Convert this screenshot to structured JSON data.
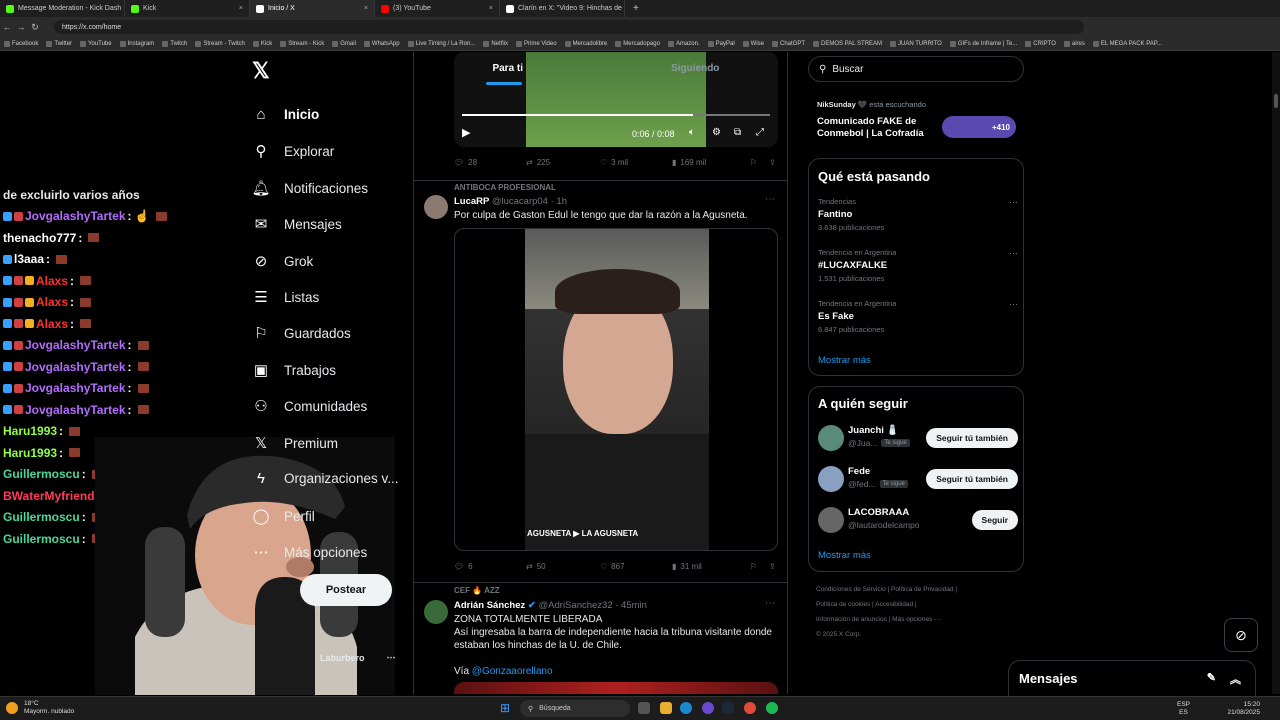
{
  "browser": {
    "tabs": [
      {
        "title": "Message Moderation - Kick Dash",
        "color": "#53fc18"
      },
      {
        "title": "Kick",
        "color": "#53fc18"
      },
      {
        "title": "Inicio / X",
        "color": "#ffffff"
      },
      {
        "title": "(3) YouTube",
        "color": "#ff0000"
      },
      {
        "title": "Clarín en X: \"Video 9: Hinchas de",
        "color": "#ffffff"
      }
    ],
    "url": "https://x.com/home",
    "bookmarks": [
      "Facebook",
      "Twitter",
      "YouTube",
      "Instagram",
      "Twitch",
      "Stream - Twitch",
      "Kick",
      "Stream - Kick",
      "Gmail",
      "WhatsApp",
      "Live Timing / La Ron...",
      "Netflix",
      "Prime Video",
      "Mercadolibre",
      "Mercadopago",
      "Amazon.",
      "PayPal",
      "Wise",
      "ChatGPT",
      "DEMOS PAL STREAM",
      "JUAN TURRITO",
      "GIFs de Inframe | Te...",
      "CRIPTO",
      "aires",
      "EL MEGA PACK PAP..."
    ]
  },
  "chat": {
    "header": "de excluirlo varios años",
    "lines": [
      {
        "user": "JovgalashyTartek",
        "color": "#b36bff",
        "badges": 2,
        "suffix": ": ☝"
      },
      {
        "user": "thenacho777",
        "color": "#ffffff",
        "badges": 0,
        "suffix": ":"
      },
      {
        "user": "l3aaa",
        "color": "#ffffff",
        "badges": 1,
        "suffix": ":"
      },
      {
        "user": "Alaxs",
        "color": "#ff3030",
        "badges": 3,
        "suffix": ":"
      },
      {
        "user": "Alaxs",
        "color": "#ff3030",
        "badges": 3,
        "suffix": ":"
      },
      {
        "user": "Alaxs",
        "color": "#ff3030",
        "badges": 3,
        "suffix": ":"
      },
      {
        "user": "JovgalashyTartek",
        "color": "#b36bff",
        "badges": 2,
        "suffix": ":"
      },
      {
        "user": "JovgalashyTartek",
        "color": "#b36bff",
        "badges": 2,
        "suffix": ":"
      },
      {
        "user": "JovgalashyTartek",
        "color": "#b36bff",
        "badges": 2,
        "suffix": ":"
      },
      {
        "user": "JovgalashyTartek",
        "color": "#b36bff",
        "badges": 2,
        "suffix": ":"
      },
      {
        "user": "Haru1993",
        "color": "#8fff4a",
        "badges": 0,
        "suffix": ":"
      },
      {
        "user": "Haru1993",
        "color": "#8fff4a",
        "badges": 0,
        "suffix": ":"
      },
      {
        "user": "Guillermoscu",
        "color": "#4ad89a",
        "badges": 0,
        "suffix": ":"
      },
      {
        "user": "BWaterMyfriend",
        "color": "#ff3a5a",
        "badges": 0,
        "suffix": ":"
      },
      {
        "user": "Guillermoscu",
        "color": "#4ad89a",
        "badges": 0,
        "suffix": ":"
      },
      {
        "user": "Guillermoscu",
        "color": "#4ad89a",
        "badges": 0,
        "suffix": ":"
      }
    ]
  },
  "xnav": {
    "items": [
      {
        "label": "Inicio",
        "icon": "home-icon",
        "glyph": "⌂"
      },
      {
        "label": "Explorar",
        "icon": "search-icon",
        "glyph": "⚲"
      },
      {
        "label": "Notificaciones",
        "icon": "bell-icon",
        "glyph": "🔔︎"
      },
      {
        "label": "Mensajes",
        "icon": "mail-icon",
        "glyph": "✉"
      },
      {
        "label": "Grok",
        "icon": "grok-icon",
        "glyph": "⊘"
      },
      {
        "label": "Listas",
        "icon": "list-icon",
        "glyph": "☰"
      },
      {
        "label": "Guardados",
        "icon": "bookmark-icon",
        "glyph": "⚐"
      },
      {
        "label": "Trabajos",
        "icon": "briefcase-icon",
        "glyph": "▣"
      },
      {
        "label": "Comunidades",
        "icon": "communities-icon",
        "glyph": "⚇"
      },
      {
        "label": "Premium",
        "icon": "x-premium-icon",
        "glyph": "𝕏"
      },
      {
        "label": "Organizaciones v...",
        "icon": "lightning-icon",
        "glyph": "ϟ"
      },
      {
        "label": "Perfil",
        "icon": "profile-icon",
        "glyph": "◯"
      },
      {
        "label": "Más opciones",
        "icon": "more-icon",
        "glyph": "⋯"
      }
    ],
    "post_label": "Postear",
    "account_name": "Laburbero"
  },
  "feed": {
    "tabs": [
      "Para ti",
      "Siguiendo"
    ],
    "post1": {
      "time": "0:06 / 0:08",
      "stats": {
        "replies": "28",
        "reposts": "225",
        "likes": "3 mil",
        "views": "169 mil"
      }
    },
    "post2": {
      "context": "ANTIBOCA PROFESIONAL",
      "name": "LucaRP",
      "handle": "@lucacarp04 · 1h",
      "text": "Por culpa de Gaston Edul le tengo que dar la razón a la Agusneta.",
      "watermark": "AGUSNETA",
      "watermark2": "LA AGUSNETA",
      "stats": {
        "replies": "6",
        "reposts": "50",
        "likes": "867",
        "views": "31 mil"
      }
    },
    "post3": {
      "context": "CEF 🔥 AZZ",
      "name": "Adrián Sánchez",
      "handle": "@AdriSanchez32 · 45min",
      "line1": "ZONA TOTALMENTE LIBERADA",
      "line2": "Así ingresaba la barra de independiente hacia la tribuna visitante donde estaban los hinchas de la U. de Chile.",
      "via_prefix": "Vía",
      "via_link": "@Gonzaaorellano"
    }
  },
  "right": {
    "search_placeholder": "Buscar",
    "spaces": {
      "host": "NikSunday 🖤",
      "status": "está escuchando",
      "title": "Comunicado FAKE de Conmebol | La Cofradía",
      "count": "+410"
    },
    "trends_title": "Qué está pasando",
    "trends": [
      {
        "cat": "Tendencias",
        "name": "Fantino",
        "count": "3.638 publicaciones"
      },
      {
        "cat": "Tendencia en Argentina",
        "name": "#LUCAXFALKE",
        "count": "1.531 publicaciones"
      },
      {
        "cat": "Tendencia en Argentina",
        "name": "Es Fake",
        "count": "6.847 publicaciones"
      }
    ],
    "show_more": "Mostrar más",
    "follow_title": "A quién seguir",
    "follow": [
      {
        "name": "Juanchi 🧂",
        "handle": "@Jua...",
        "tag": "Te sigue",
        "btn": "Seguir tú también",
        "color": "#5a8a7a"
      },
      {
        "name": "Fede",
        "handle": "@fed...",
        "tag": "Te sigue",
        "btn": "Seguir tú también",
        "color": "#8aa0c0"
      },
      {
        "name": "LACOBRAAA",
        "handle": "@lautarodelcampo",
        "tag": "",
        "btn": "Seguir",
        "color": "#666666"
      }
    ],
    "footer1": "Condiciones de Servicio  |  Política de Privacidad  |",
    "footer2": "Política de cookies  |  Accesibilidad  |",
    "footer3": "Información de anuncios  |  Más opciones ···",
    "footer4": "© 2025 X Corp.",
    "messages": "Mensajes"
  },
  "taskbar": {
    "temp": "18°C",
    "weather": "Mayorm. nublado",
    "search": "Búsqueda",
    "lang1": "ESP",
    "lang2": "ES",
    "time": "15:20",
    "date": "21/08/2025"
  }
}
